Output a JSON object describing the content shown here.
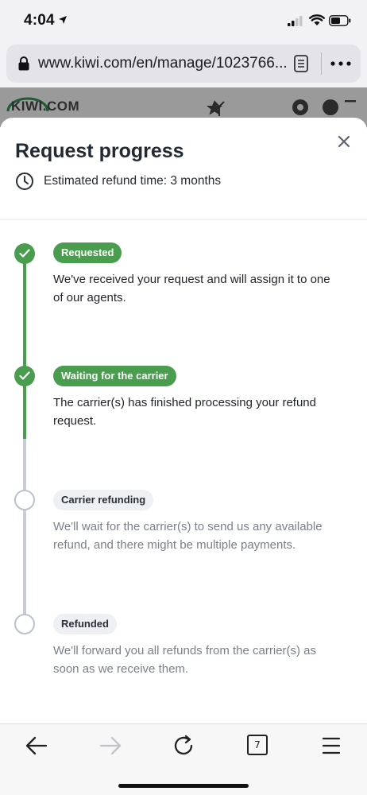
{
  "status_bar": {
    "time": "4:04"
  },
  "browser": {
    "url": "www.kiwi.com/en/manage/1023766...",
    "tabs_count": "7"
  },
  "background_page": {
    "logo_text": "KIWI.COM"
  },
  "modal": {
    "title": "Request progress",
    "eta_text": "Estimated refund time: 3 months",
    "steps": [
      {
        "label": "Requested",
        "state": "done",
        "description": "We've received your request and will assign it to one of our agents."
      },
      {
        "label": "Waiting for the carrier",
        "state": "done",
        "description": "The carrier(s) has finished processing your refund request."
      },
      {
        "label": "Carrier refunding",
        "state": "pending",
        "description": "We'll wait for the carrier(s) to send us any available refund, and there might be multiple payments."
      },
      {
        "label": "Refunded",
        "state": "pending",
        "description": "We'll forward you all refunds from the carrier(s) as soon as we receive them."
      }
    ]
  },
  "colors": {
    "accent_green": "#4a9d4e",
    "pending_grey": "#c7ccd6"
  }
}
